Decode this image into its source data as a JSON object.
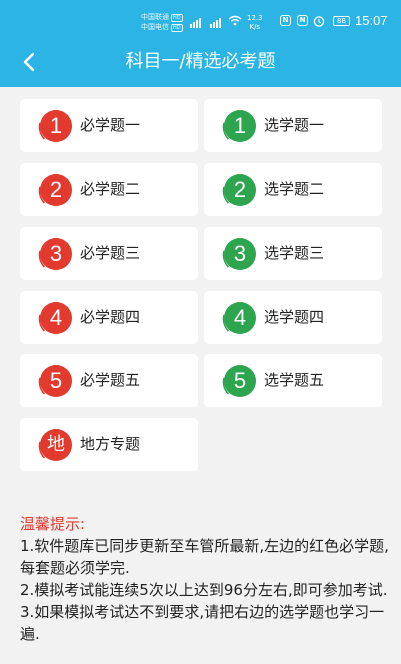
{
  "status_bar": {
    "carrier1": "中国联通",
    "carrier2": "中国电信",
    "hd": "HD",
    "net_speed_value": "12.3",
    "net_speed_unit": "K/s",
    "battery": "88",
    "time": "15:07"
  },
  "header": {
    "title": "科目一/精选必考题"
  },
  "colors": {
    "header_bg": "#2cb4e4",
    "required_red": "#e23a2e",
    "elective_green": "#2da44e",
    "tips_red": "#e23a2e"
  },
  "required": [
    {
      "num": "1",
      "label": "必学题一"
    },
    {
      "num": "2",
      "label": "必学题二"
    },
    {
      "num": "3",
      "label": "必学题三"
    },
    {
      "num": "4",
      "label": "必学题四"
    },
    {
      "num": "5",
      "label": "必学题五"
    }
  ],
  "elective": [
    {
      "num": "1",
      "label": "选学题一"
    },
    {
      "num": "2",
      "label": "选学题二"
    },
    {
      "num": "3",
      "label": "选学题三"
    },
    {
      "num": "4",
      "label": "选学题四"
    },
    {
      "num": "5",
      "label": "选学题五"
    }
  ],
  "local": {
    "num": "地",
    "label": "地方专题"
  },
  "tips": {
    "title": "温馨提示:",
    "line1": "1.软件题库已同步更新至车管所最新,左边的红色必学题,每套题必须学完.",
    "line2": "2.模拟考试能连续5次以上达到96分左右,即可参加考试.",
    "line3": "3.如果模拟考试达不到要求,请把右边的选学题也学习一遍."
  }
}
